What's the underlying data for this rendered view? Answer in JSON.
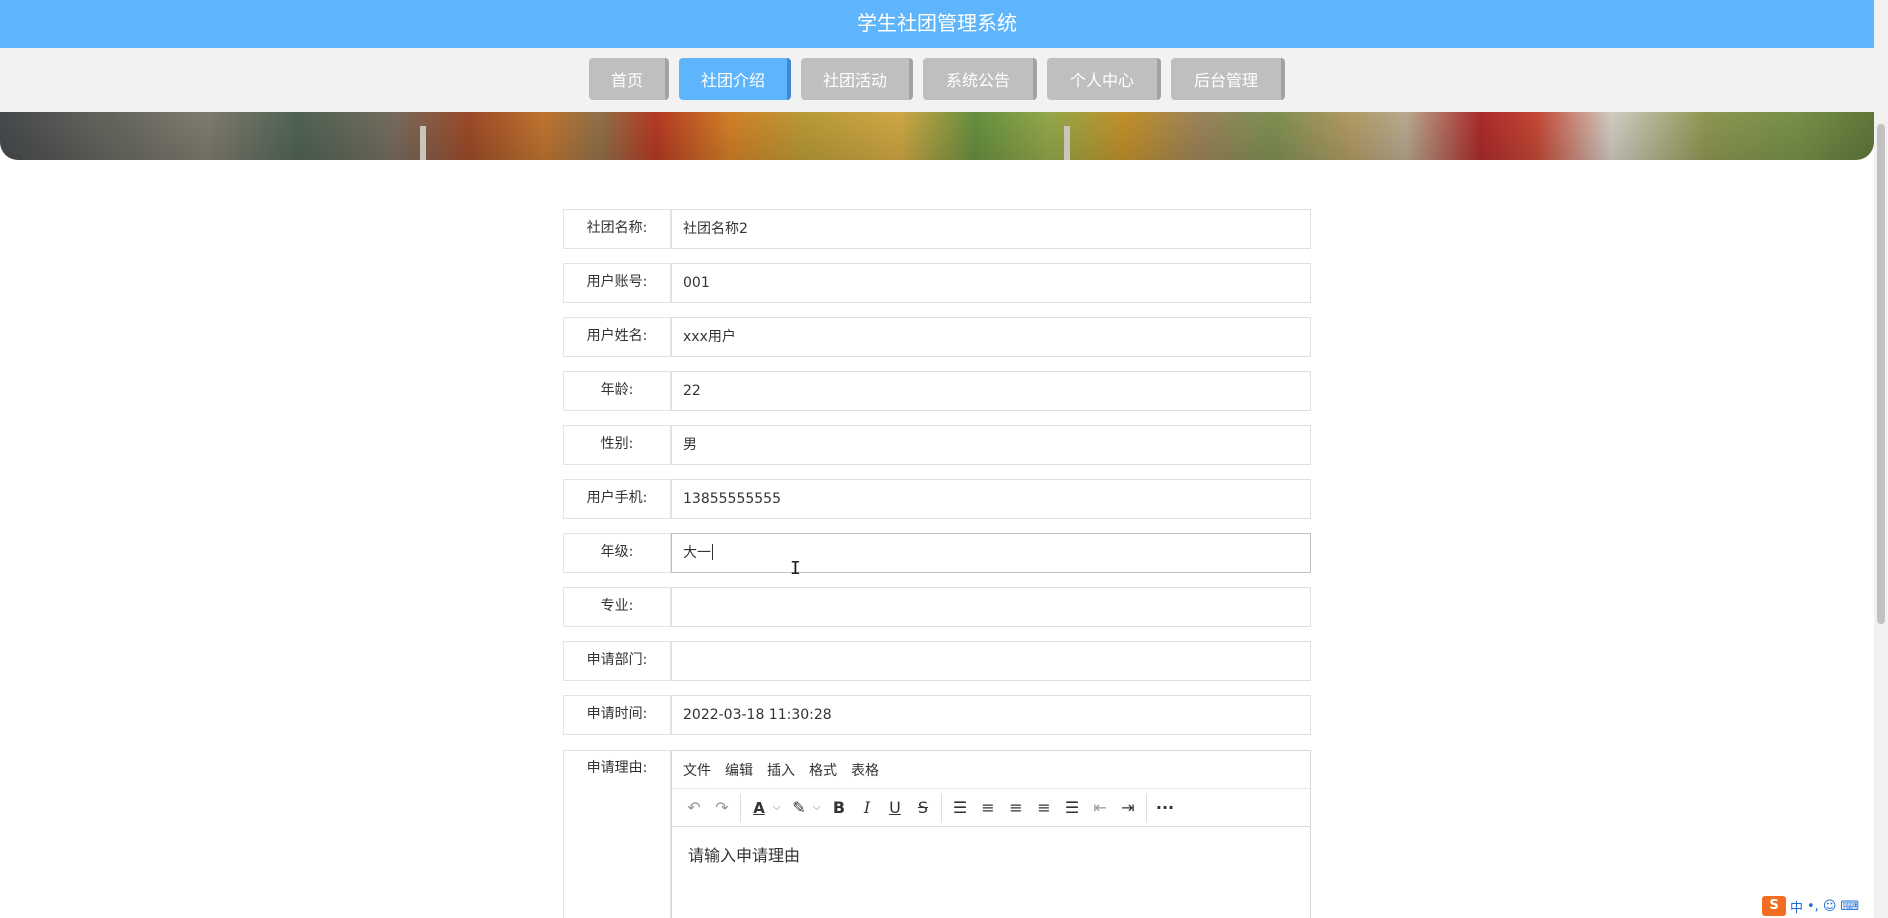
{
  "header": {
    "title": "学生社团管理系统"
  },
  "nav": [
    {
      "label": "首页",
      "active": false
    },
    {
      "label": "社团介绍",
      "active": true
    },
    {
      "label": "社团活动",
      "active": false
    },
    {
      "label": "系统公告",
      "active": false
    },
    {
      "label": "个人中心",
      "active": false
    },
    {
      "label": "后台管理",
      "active": false
    }
  ],
  "form": {
    "rows": [
      {
        "label": "社团名称:",
        "value": "社团名称2"
      },
      {
        "label": "用户账号:",
        "value": "001"
      },
      {
        "label": "用户姓名:",
        "value": "xxx用户"
      },
      {
        "label": "年龄:",
        "value": "22"
      },
      {
        "label": "性别:",
        "value": "男"
      },
      {
        "label": "用户手机:",
        "value": "13855555555"
      },
      {
        "label": "年级:",
        "value": "大一"
      },
      {
        "label": "专业:",
        "value": ""
      },
      {
        "label": "申请部门:",
        "value": ""
      },
      {
        "label": "申请时间:",
        "value": "2022-03-18 11:30:28"
      }
    ],
    "reason": {
      "label": "申请理由:",
      "menu": [
        "文件",
        "编辑",
        "插入",
        "格式",
        "表格"
      ],
      "placeholder": "请输入申请理由"
    }
  },
  "colors": {
    "header_bg": "#5eb5fb",
    "nav_inactive": "#bfbfbf",
    "nav_active": "#5eb5fb"
  },
  "ime": {
    "logo": "S",
    "mode": "中",
    "punct": "•,",
    "emoji_icon": "emoji-icon",
    "keyboard_icon": "keyboard-icon"
  }
}
